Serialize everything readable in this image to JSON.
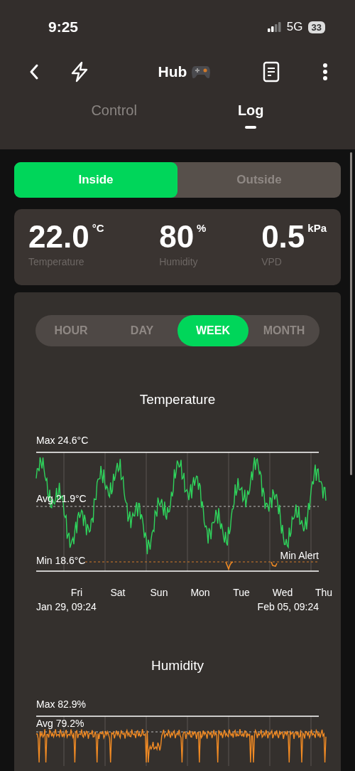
{
  "status_bar": {
    "time": "9:25",
    "network": "5G",
    "battery": "33"
  },
  "header": {
    "title": "Hub"
  },
  "tabs": [
    {
      "label": "Control",
      "selected": false
    },
    {
      "label": "Log",
      "selected": true
    }
  ],
  "location_toggle": [
    {
      "label": "Inside",
      "selected": true
    },
    {
      "label": "Outside",
      "selected": false
    }
  ],
  "readings": [
    {
      "value": "22.0",
      "unit": "°C",
      "label": "Temperature"
    },
    {
      "value": "80",
      "unit": "%",
      "label": "Humidity"
    },
    {
      "value": "0.5",
      "unit": "kPa",
      "label": "VPD"
    }
  ],
  "periods": [
    {
      "label": "HOUR",
      "selected": false
    },
    {
      "label": "DAY",
      "selected": false
    },
    {
      "label": "WEEK",
      "selected": true
    },
    {
      "label": "MONTH",
      "selected": false
    }
  ],
  "charts": [
    {
      "title": "Temperature",
      "max_label": "Max 24.6°C",
      "avg_label": "Avg 21.9°C",
      "min_label": "Min 18.6°C",
      "alert_label": "Min Alert",
      "day_labels": [
        "Fri",
        "Sat",
        "Sun",
        "Mon",
        "Tue",
        "Wed",
        "Thu"
      ],
      "start_label": "Jan 29, 09:24",
      "end_label": "Feb 05, 09:24"
    },
    {
      "title": "Humidity",
      "max_label": "Max 82.9%",
      "avg_label": "Avg 79.2%"
    }
  ]
}
